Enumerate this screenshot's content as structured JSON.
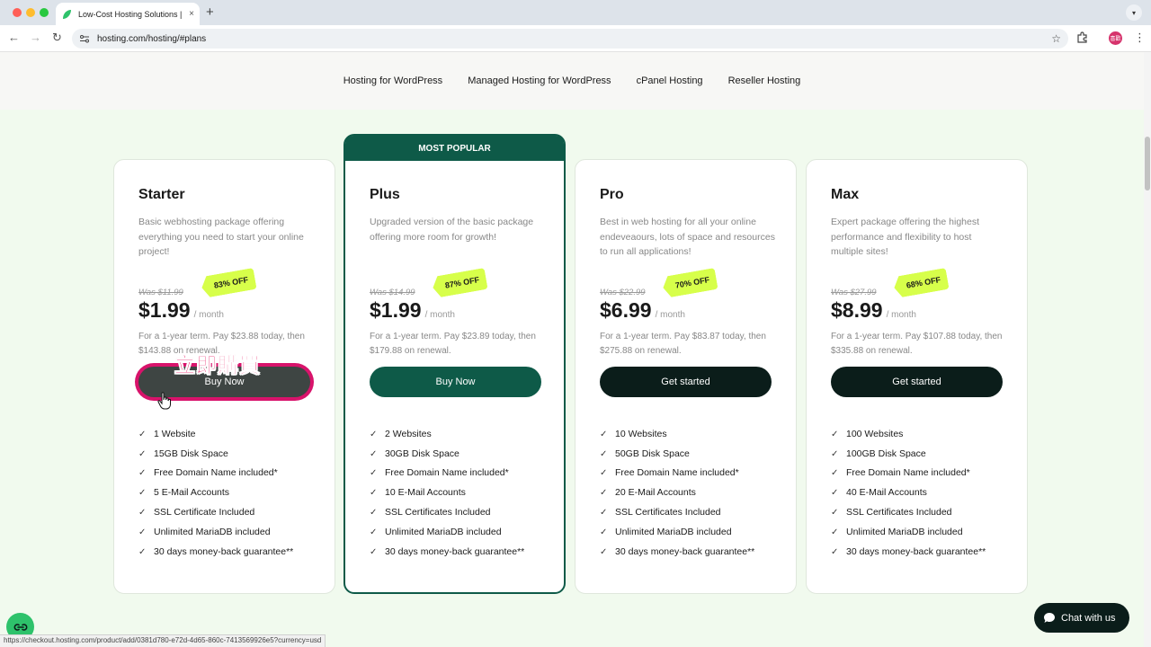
{
  "browser": {
    "tab_title": "Low-Cost Hosting Solutions |",
    "tab_close": "×",
    "new_tab": "+",
    "url": "hosting.com/hosting/#plans",
    "profile_initials": "喜歡",
    "status_url": "https://checkout.hosting.com/product/add/0381d780-e72d-4d65-860c-7413569926e5?currency=usd"
  },
  "subnav": [
    "Hosting for WordPress",
    "Managed Hosting for WordPress",
    "cPanel Hosting",
    "Reseller Hosting"
  ],
  "popular_label": "MOST POPULAR",
  "plans": [
    {
      "name": "Starter",
      "description": "Basic webhosting package offering everything you need to start your online project!",
      "was": "Was $11.99",
      "discount": "83% OFF",
      "price": "$1.99",
      "per": "/ month",
      "term": "For a 1-year term. Pay $23.88 today, then $143.88 on renewal.",
      "cta": "Buy Now",
      "features": [
        "1 Website",
        "15GB Disk Space",
        "Free Domain Name included*",
        "5 E-Mail Accounts",
        "SSL Certificate Included",
        "Unlimited MariaDB included",
        "30 days money-back guarantee**"
      ]
    },
    {
      "name": "Plus",
      "description": "Upgraded version of the basic package offering more room for growth!",
      "was": "Was $14.99",
      "discount": "87% OFF",
      "price": "$1.99",
      "per": "/ month",
      "term": "For a 1-year term. Pay $23.89 today, then $179.88 on renewal.",
      "cta": "Buy Now",
      "features": [
        "2 Websites",
        "30GB Disk Space",
        "Free Domain Name included*",
        "10 E-Mail Accounts",
        "SSL Certificates Included",
        "Unlimited MariaDB included",
        "30 days money-back guarantee**"
      ]
    },
    {
      "name": "Pro",
      "description": "Best in web hosting for all your online endeveaours, lots of space and resources to run all applications!",
      "was": "Was $22.99",
      "discount": "70% OFF",
      "price": "$6.99",
      "per": "/ month",
      "term": "For a 1-year term. Pay $83.87 today, then $275.88 on renewal.",
      "cta": "Get started",
      "features": [
        "10 Websites",
        "50GB Disk Space",
        "Free Domain Name included*",
        "20 E-Mail Accounts",
        "SSL Certificates Included",
        "Unlimited MariaDB included",
        "30 days money-back guarantee**"
      ]
    },
    {
      "name": "Max",
      "description": "Expert package offering the highest performance and flexibility to host multiple sites!",
      "was": "Was $27.99",
      "discount": "68% OFF",
      "price": "$8.99",
      "per": "/ month",
      "term": "For a 1-year term. Pay $107.88 today, then $335.88 on renewal.",
      "cta": "Get started",
      "features": [
        "100 Websites",
        "100GB Disk Space",
        "Free Domain Name included*",
        "40 E-Mail Accounts",
        "SSL Certificates Included",
        "Unlimited MariaDB included",
        "30 days money-back guarantee**"
      ]
    }
  ],
  "annotation": "立即購買",
  "chat_label": "Chat with us",
  "colors": {
    "brand_green": "#0e5a48",
    "badge_lime": "#d7ff4a",
    "annotation_pink": "#e8145f",
    "dark_button": "#0b1d1a"
  }
}
